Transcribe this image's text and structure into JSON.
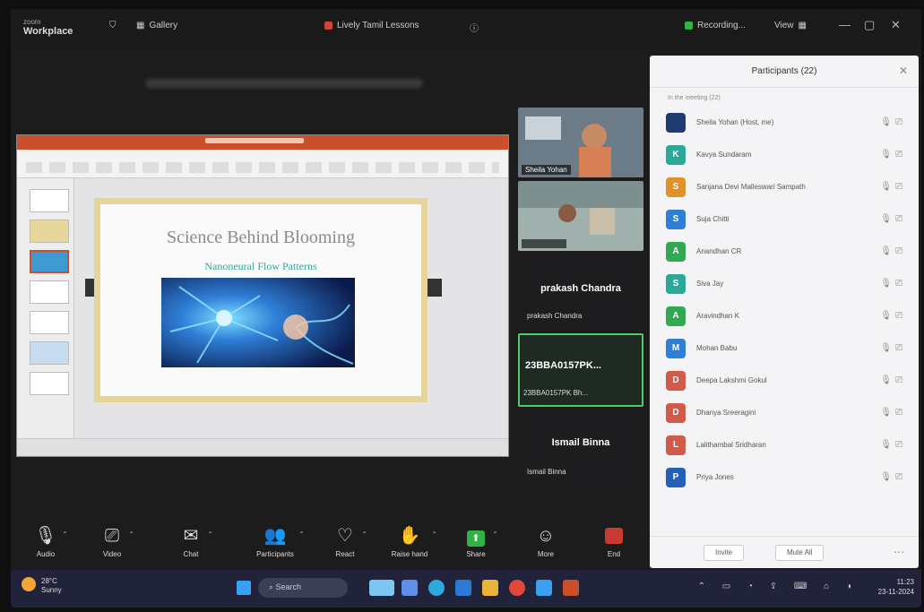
{
  "topbar": {
    "app_small": "zoom",
    "app_name": "Workplace",
    "view_label": "Gallery",
    "screen_share_label": "Lively Tamil Lessons",
    "recording_label": "Recording...",
    "view_mode": "View"
  },
  "slide": {
    "title": "Science Behind Blooming",
    "subtitle": "Nanoneural Flow Patterns"
  },
  "gallery": {
    "tile1_name": "Sheila Yohan",
    "tile3_big": "prakash Chandra",
    "tile3_small": "prakash Chandra",
    "tile4_big": "23BBA0157PK...",
    "tile4_small": "23BBA0157PK Bh...",
    "tile5_big": "Ismail Binna",
    "tile5_small": "Ismail Binna"
  },
  "panel": {
    "title": "Participants (22)",
    "section_label": "In the meeting (22)",
    "participants": [
      {
        "initial": "",
        "name": "Sheila Yohan (Host, me)",
        "color": "#1f3a6e"
      },
      {
        "initial": "K",
        "name": "Kavya Sundaram",
        "color": "#2aa89a"
      },
      {
        "initial": "S",
        "name": "Sanjana Devi Malleswari Sampath",
        "color": "#e0922a"
      },
      {
        "initial": "S",
        "name": "Suja Chitti",
        "color": "#2f7fd8"
      },
      {
        "initial": "A",
        "name": "Anandhan CR",
        "color": "#31a852"
      },
      {
        "initial": "S",
        "name": "Siva Jay",
        "color": "#2aa89a"
      },
      {
        "initial": "A",
        "name": "Aravindhan K",
        "color": "#31a852"
      },
      {
        "initial": "M",
        "name": "Mohan Babu",
        "color": "#2f7fd8"
      },
      {
        "initial": "D",
        "name": "Deepa Lakshmi Gokul",
        "color": "#d15a4a"
      },
      {
        "initial": "D",
        "name": "Dhanya Sreeragini",
        "color": "#d15a4a"
      },
      {
        "initial": "L",
        "name": "Lalithambal Sridharan",
        "color": "#d15a4a"
      },
      {
        "initial": "P",
        "name": "Priya Jones",
        "color": "#2560b8"
      }
    ],
    "invite_label": "Invite",
    "mute_all_label": "Mute All"
  },
  "toolbar": {
    "audio": "Audio",
    "video": "Video",
    "chat": "Chat",
    "participants": "Participants",
    "react": "React",
    "raise_hand": "Raise hand",
    "share": "Share",
    "more": "More",
    "end": "End"
  },
  "taskbar": {
    "weather_temp": "28°C",
    "weather_desc": "Sunny",
    "search_label": "Search",
    "time": "11:23",
    "date": "23-11-2024"
  }
}
